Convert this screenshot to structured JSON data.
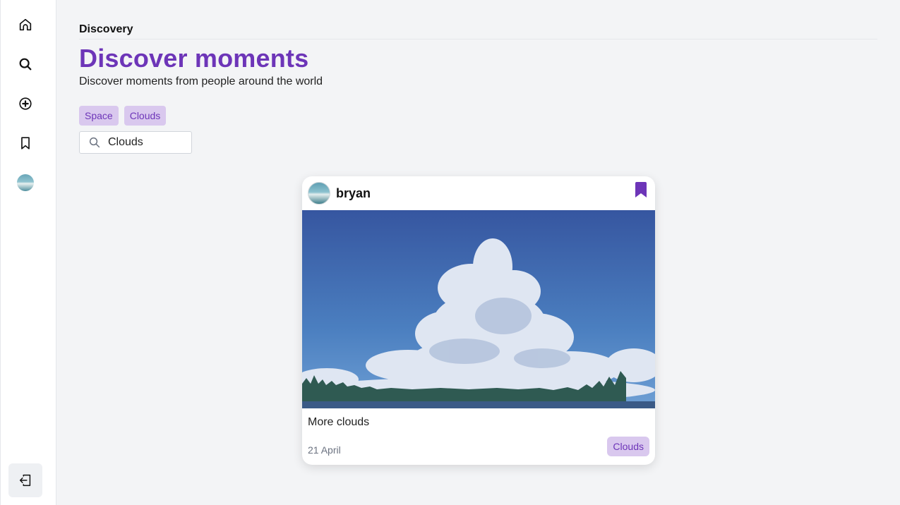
{
  "header": {
    "breadcrumb": "Discovery",
    "title": "Discover moments",
    "subtitle": "Discover moments from people around the world"
  },
  "sidebar": {
    "items": [
      {
        "icon": "home-icon"
      },
      {
        "icon": "search-icon"
      },
      {
        "icon": "plus-circle-icon"
      },
      {
        "icon": "bookmark-icon"
      },
      {
        "icon": "avatar"
      }
    ],
    "logout_icon": "logout-icon"
  },
  "filters": {
    "tags": [
      "Space",
      "Clouds"
    ],
    "search_value": "Clouds"
  },
  "post": {
    "username": "bryan",
    "caption": "More clouds",
    "date": "21 April",
    "tag": "Clouds",
    "bookmarked": true
  },
  "colors": {
    "accent": "#6d35b8",
    "tag_bg": "#d9c8ee",
    "background": "#f3f4f6"
  }
}
